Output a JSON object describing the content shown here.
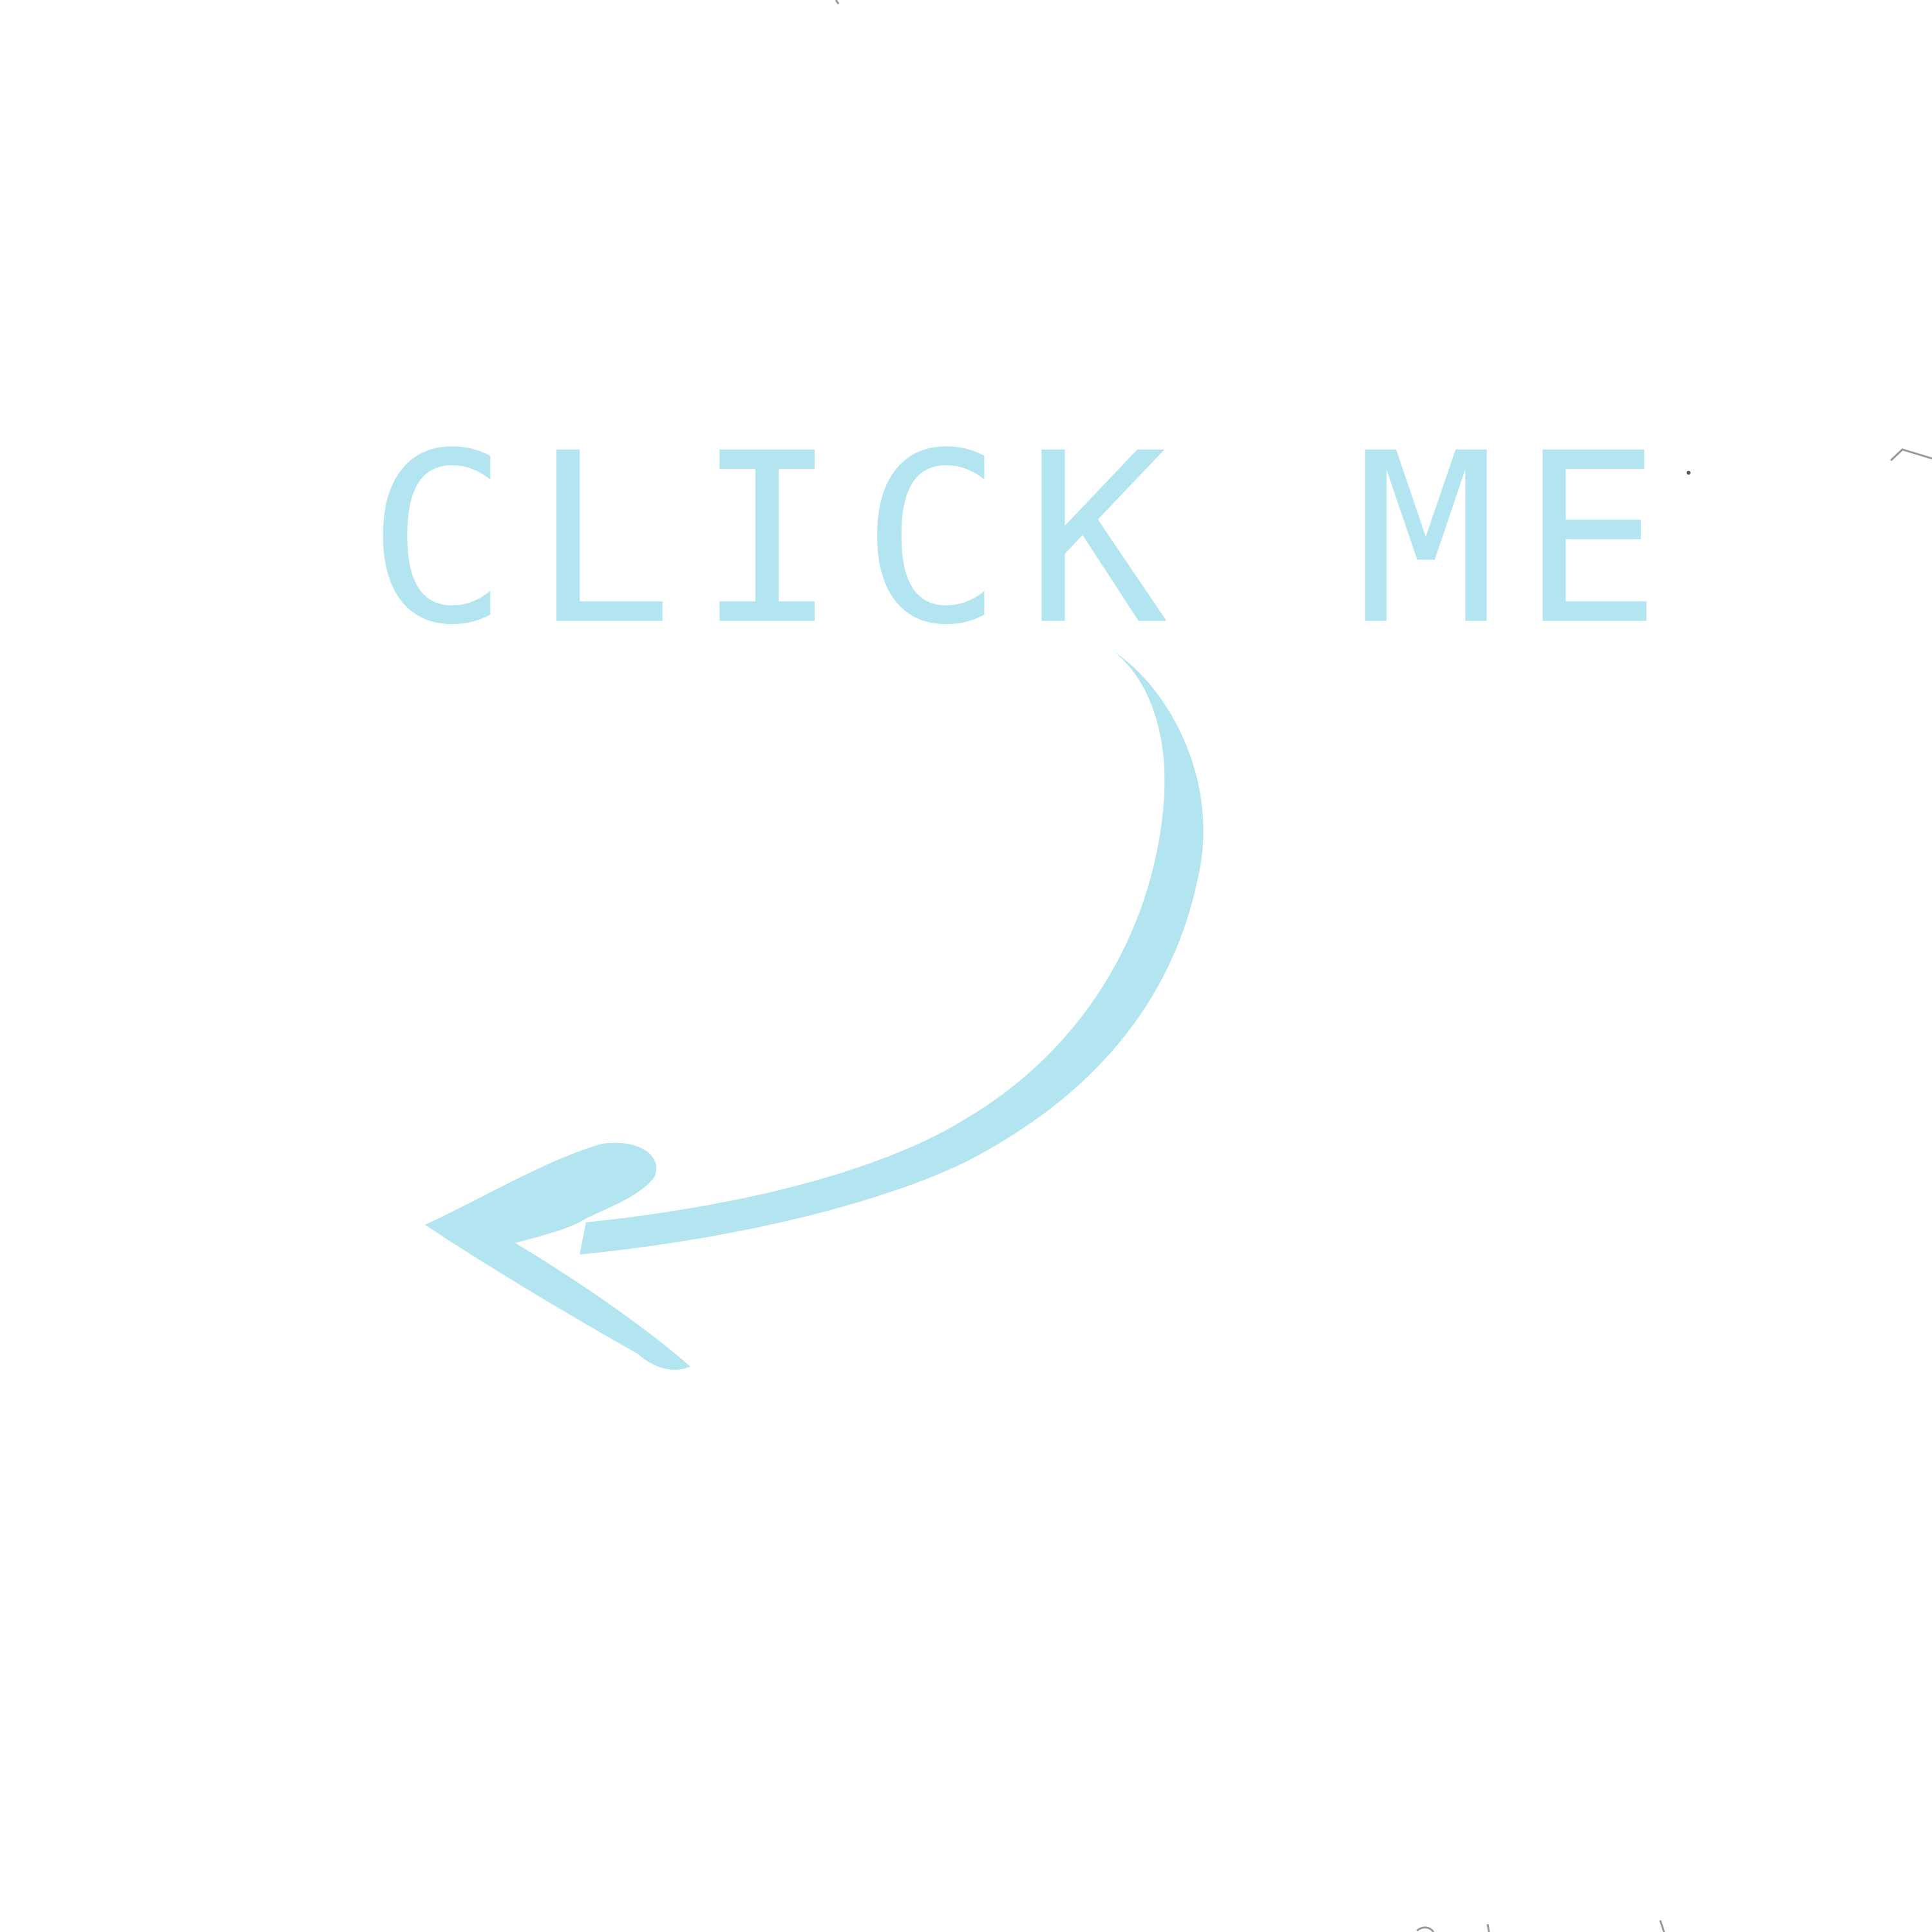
{
  "cta": {
    "label": "CLICK ME"
  },
  "icons": {
    "arrow": "curved-arrow-left-icon"
  },
  "colors": {
    "background": "#ffffff",
    "accent": "#b3e5f0",
    "sketch": "#999999"
  }
}
